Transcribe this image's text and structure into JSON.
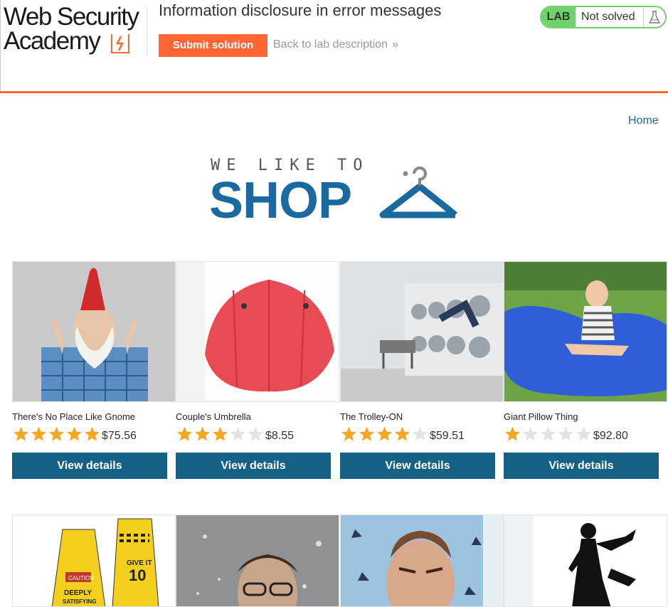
{
  "header": {
    "logo_line1": "Web Security",
    "logo_line2": "Academy",
    "lab_title": "Information disclosure in error messages",
    "submit_label": "Submit solution",
    "back_label": "Back to lab description",
    "back_chevron": "»",
    "lab_badge": "LAB",
    "status": "Not solved",
    "status_icon": "flask-icon",
    "accent_color": "#ff6633",
    "solved_color": "#70d16d"
  },
  "nav": {
    "home_label": "Home"
  },
  "shop_logo": {
    "tagline": "WE LIKE TO",
    "word": "SHOP",
    "icon": "hanger-icon",
    "color": "#1a6aa0"
  },
  "products": [
    {
      "name": "There's No Place Like Gnome",
      "rating": 5,
      "price": "$75.56",
      "button": "View details",
      "image": "gnome-man"
    },
    {
      "name": "Couple's Umbrella",
      "rating": 3,
      "price": "$8.55",
      "button": "View details",
      "image": "red-umbrella"
    },
    {
      "name": "The Trolley-ON",
      "rating": 4,
      "price": "$59.51",
      "button": "View details",
      "image": "laundromat"
    },
    {
      "name": "Giant Pillow Thing",
      "rating": 1,
      "price": "$92.80",
      "button": "View details",
      "image": "blue-pillow-girl"
    }
  ],
  "products_row2": [
    {
      "image": "caution-signs",
      "sign_text": "CAUTION DEEPLY SATISFYING",
      "sign2_text": "GIVE IT 10"
    },
    {
      "image": "water-splash-face"
    },
    {
      "image": "squinting-man"
    },
    {
      "image": "silhouette-figure"
    }
  ],
  "button_color": "#146185",
  "star_color": "#f5a623"
}
